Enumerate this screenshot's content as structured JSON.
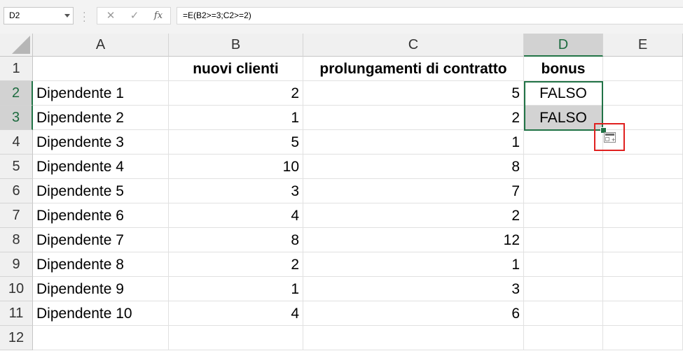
{
  "formula_bar": {
    "name_box": "D2",
    "cancel_icon": "✕",
    "enter_icon": "✓",
    "fx_label": "fx",
    "formula": "=E(B2>=3;C2>=2)"
  },
  "columns": [
    "A",
    "B",
    "C",
    "D",
    "E"
  ],
  "selected_column": "D",
  "rows": [
    "1",
    "2",
    "3",
    "4",
    "5",
    "6",
    "7",
    "8",
    "9",
    "10",
    "11",
    "12"
  ],
  "selected_rows": [
    "2",
    "3"
  ],
  "header_row": {
    "a": "",
    "b": "nuovi clienti",
    "c": "prolungamenti di contratto",
    "d": "bonus"
  },
  "data_rows": [
    {
      "a": "Dipendente 1",
      "b": "2",
      "c": "5",
      "d": "FALSO"
    },
    {
      "a": "Dipendente 2",
      "b": "1",
      "c": "2",
      "d": "FALSO"
    },
    {
      "a": "Dipendente 3",
      "b": "5",
      "c": "1",
      "d": ""
    },
    {
      "a": "Dipendente 4",
      "b": "10",
      "c": "8",
      "d": ""
    },
    {
      "a": "Dipendente 5",
      "b": "3",
      "c": "7",
      "d": ""
    },
    {
      "a": "Dipendente 6",
      "b": "4",
      "c": "2",
      "d": ""
    },
    {
      "a": "Dipendente 7",
      "b": "8",
      "c": "12",
      "d": ""
    },
    {
      "a": "Dipendente 8",
      "b": "2",
      "c": "1",
      "d": ""
    },
    {
      "a": "Dipendente 9",
      "b": "1",
      "c": "3",
      "d": ""
    },
    {
      "a": "Dipendente 10",
      "b": "4",
      "c": "6",
      "d": ""
    }
  ],
  "colors": {
    "selection": "#217346",
    "highlight": "#e0201f",
    "selected_fill": "#d3d3d3"
  }
}
